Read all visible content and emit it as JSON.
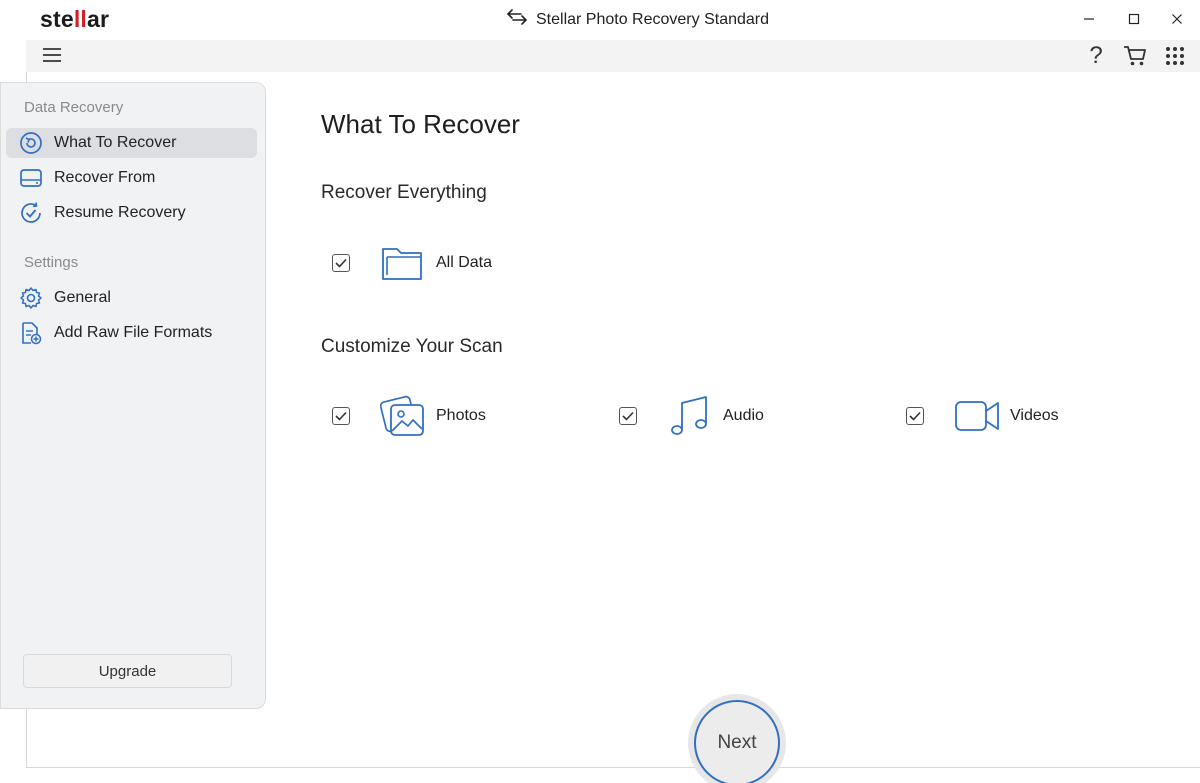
{
  "app": {
    "logo_prefix": "ste",
    "logo_mark": "ll",
    "logo_suffix": "ar",
    "window_title": "Stellar Photo Recovery Standard"
  },
  "colors": {
    "accent_blue": "#2f6fc4",
    "logo_red": "#d0202a",
    "sidebar_bg": "#f1f2f4",
    "active_item_bg": "#dcdee2"
  },
  "toolbar": {
    "menu_icon": "hamburger-icon",
    "help_label": "?",
    "cart_icon": "cart-icon",
    "apps_icon": "grid-icon"
  },
  "sidebar": {
    "section_data_recovery": "Data Recovery",
    "section_settings": "Settings",
    "items": [
      {
        "label": "What To Recover",
        "icon": "restore-icon",
        "active": true
      },
      {
        "label": "Recover From",
        "icon": "drive-icon",
        "active": false
      },
      {
        "label": "Resume Recovery",
        "icon": "resume-icon",
        "active": false
      },
      {
        "label": "General",
        "icon": "gear-icon",
        "active": false
      },
      {
        "label": "Add Raw File Formats",
        "icon": "add-file-icon",
        "active": false
      }
    ],
    "upgrade_label": "Upgrade"
  },
  "main": {
    "title": "What To Recover",
    "recover_everything": {
      "heading": "Recover Everything",
      "options": [
        {
          "label": "All Data",
          "checked": true,
          "icon": "folder-icon"
        }
      ]
    },
    "customize": {
      "heading": "Customize Your Scan",
      "options": [
        {
          "label": "Photos",
          "checked": true,
          "icon": "photos-icon"
        },
        {
          "label": "Audio",
          "checked": true,
          "icon": "music-icon"
        },
        {
          "label": "Videos",
          "checked": true,
          "icon": "video-icon"
        }
      ]
    },
    "next_label": "Next"
  }
}
